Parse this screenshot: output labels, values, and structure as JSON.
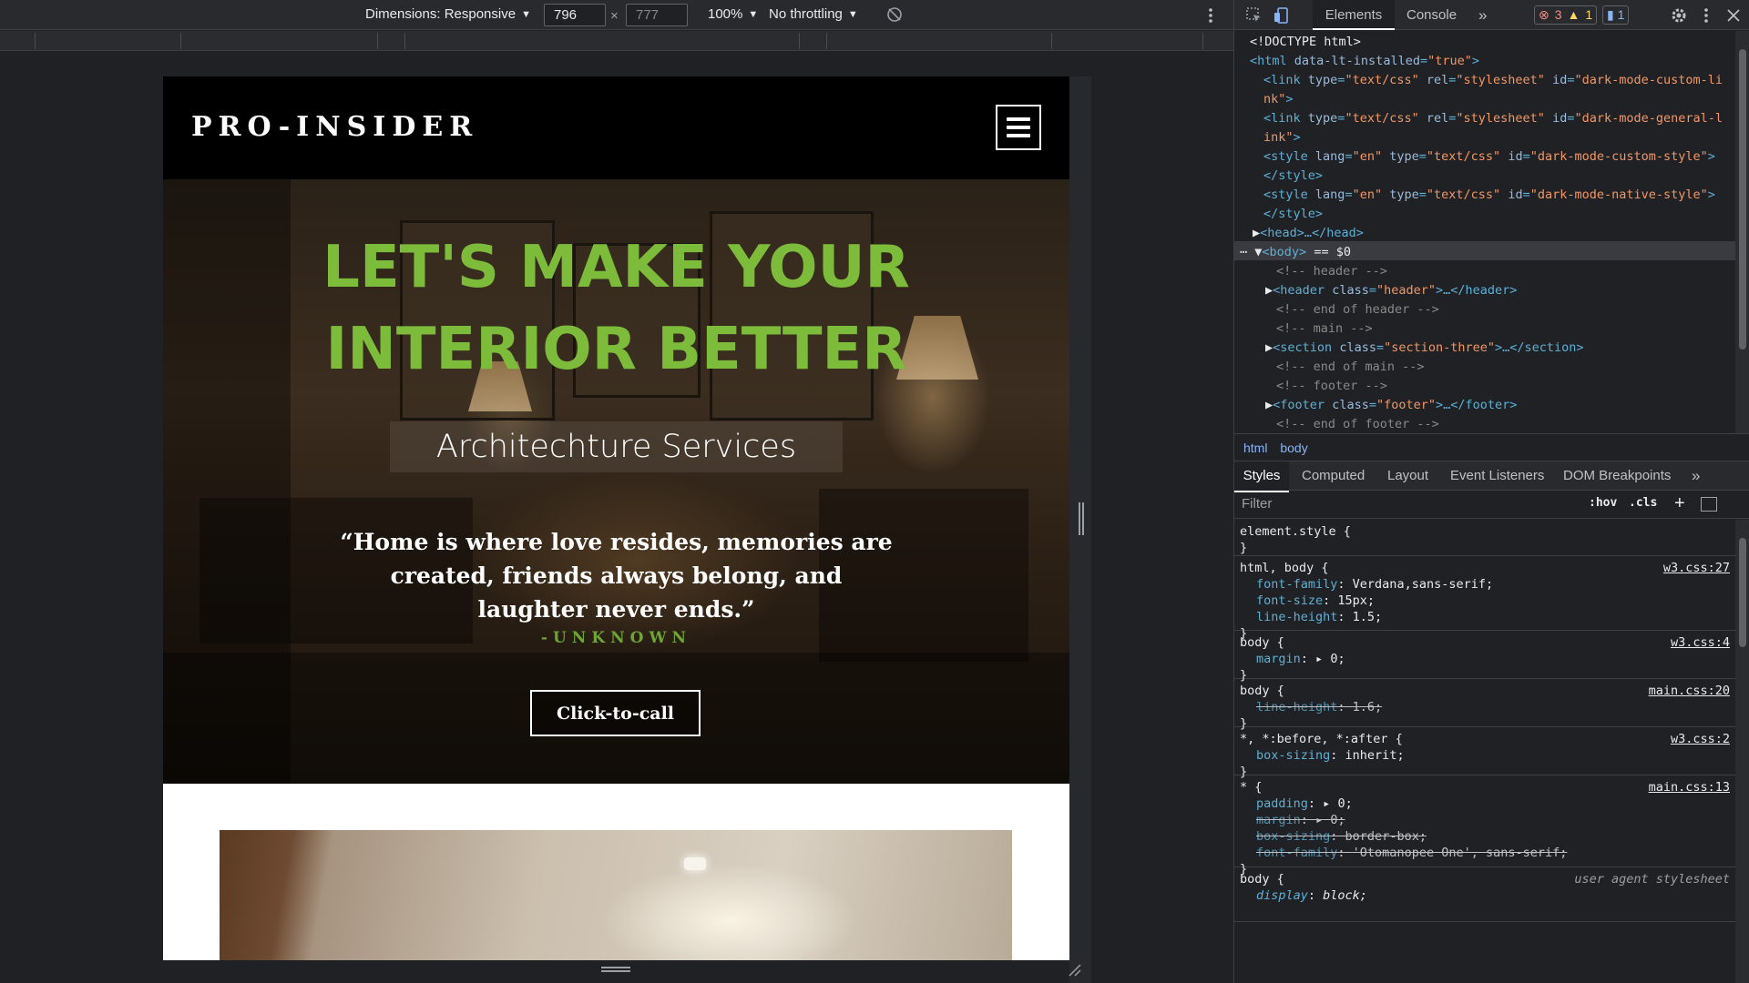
{
  "device_toolbar": {
    "dimensions_label": "Dimensions: Responsive",
    "width_value": "796",
    "height_placeholder": "777",
    "times": "×",
    "zoom": "100%",
    "throttling": "No throttling"
  },
  "site": {
    "logo": "PRO-INSIDER",
    "hero_title_line1": "LET'S MAKE YOUR",
    "hero_title_line2": "INTERIOR BETTER",
    "subtitle": "Architechture Services",
    "quote": "“Home is where love resides, memories are created, friends always belong, and laughter never ends.”",
    "quote_author": "-UNKNOWN",
    "call_button": "Click-to-call",
    "colors": {
      "accent_green": "#7cbc3a",
      "header_bg": "#000000"
    }
  },
  "devtools": {
    "tabs": {
      "elements": "Elements",
      "console": "Console"
    },
    "errors": "3",
    "warnings": "1",
    "messages": "1",
    "breadcrumbs": [
      "html",
      "body"
    ],
    "styles_tabs": [
      "Styles",
      "Computed",
      "Layout",
      "Event Listeners",
      "DOM Breakpoints"
    ],
    "filter_placeholder": "Filter",
    "hov": ":hov",
    "cls": ".cls",
    "dom": {
      "doctype": "<!DOCTYPE html>",
      "html_open": "<html",
      "html_attr": "data-lt-installed",
      "html_attr_val": "\"true\"",
      "link": "<link",
      "type_attr": "type",
      "type_css": "\"text/css\"",
      "rel_attr": "rel",
      "rel_val": "\"stylesheet\"",
      "id_attr": "id",
      "link1_id": "\"dark-mode-custom-li",
      "link1_id_cont": "nk\"",
      "link2_id": "\"dark-mode-general-l",
      "link2_id_cont": "ink\"",
      "style": "<style",
      "lang_attr": "lang",
      "lang_en": "\"en\"",
      "style1_id": "\"dark-mode-custom-style\"",
      "style2_id": "\"dark-mode-native-style\"",
      "style_close": "</style>",
      "head": "<head>…</head>",
      "body": "<body>",
      "body_marker": "== $0",
      "cm_header": "<!-- header -->",
      "header_open": "<header",
      "class_attr": "class",
      "header_class": "\"header\"",
      "header_close": ">…</header>",
      "cm_end_header": "<!-- end of header -->",
      "cm_main": "<!-- main -->",
      "section_open": "<section",
      "section_class": "\"section-three\"",
      "section_close": ">…</section>",
      "cm_end_main": "<!-- end of main -->",
      "cm_footer": "<!-- footer -->",
      "footer_open": "<footer",
      "footer_class": "\"footer\"",
      "footer_close": ">…</footer>",
      "cm_end_footer": "<!-- end of footer -->"
    },
    "rules": {
      "r0_sel": "element.style {",
      "r1_sel": "html, body {",
      "r1_src": "w3.css:27",
      "r1_p1n": "font-family",
      "r1_p1v": "Verdana,sans-serif;",
      "r1_p2n": "font-size",
      "r1_p2v": "15px;",
      "r1_p3n": "line-height",
      "r1_p3v": "1.5;",
      "r2_sel": "body {",
      "r2_src": "w3.css:4",
      "r2_p1n": "margin",
      "r2_p1v": "0;",
      "r3_sel": "body {",
      "r3_src": "main.css:20",
      "r3_p1n": "line-height",
      "r3_p1v": "1.6;",
      "r4_sel": "*, *:before, *:after {",
      "r4_src": "w3.css:2",
      "r4_p1n": "box-sizing",
      "r4_p1v": "inherit;",
      "r5_sel": "* {",
      "r5_src": "main.css:13",
      "r5_p1n": "padding",
      "r5_p1v": "0;",
      "r5_p2n": "margin",
      "r5_p2v": "0;",
      "r5_p3n": "box-sizing",
      "r5_p3v": "border-box;",
      "r5_p4n": "font-family",
      "r5_p4v": "'Otomanopee One', sans-serif;",
      "r6_sel": "body {",
      "r6_src": "user agent stylesheet",
      "r6_p1n": "display",
      "r6_p1v": "block;",
      "close": "}"
    }
  }
}
